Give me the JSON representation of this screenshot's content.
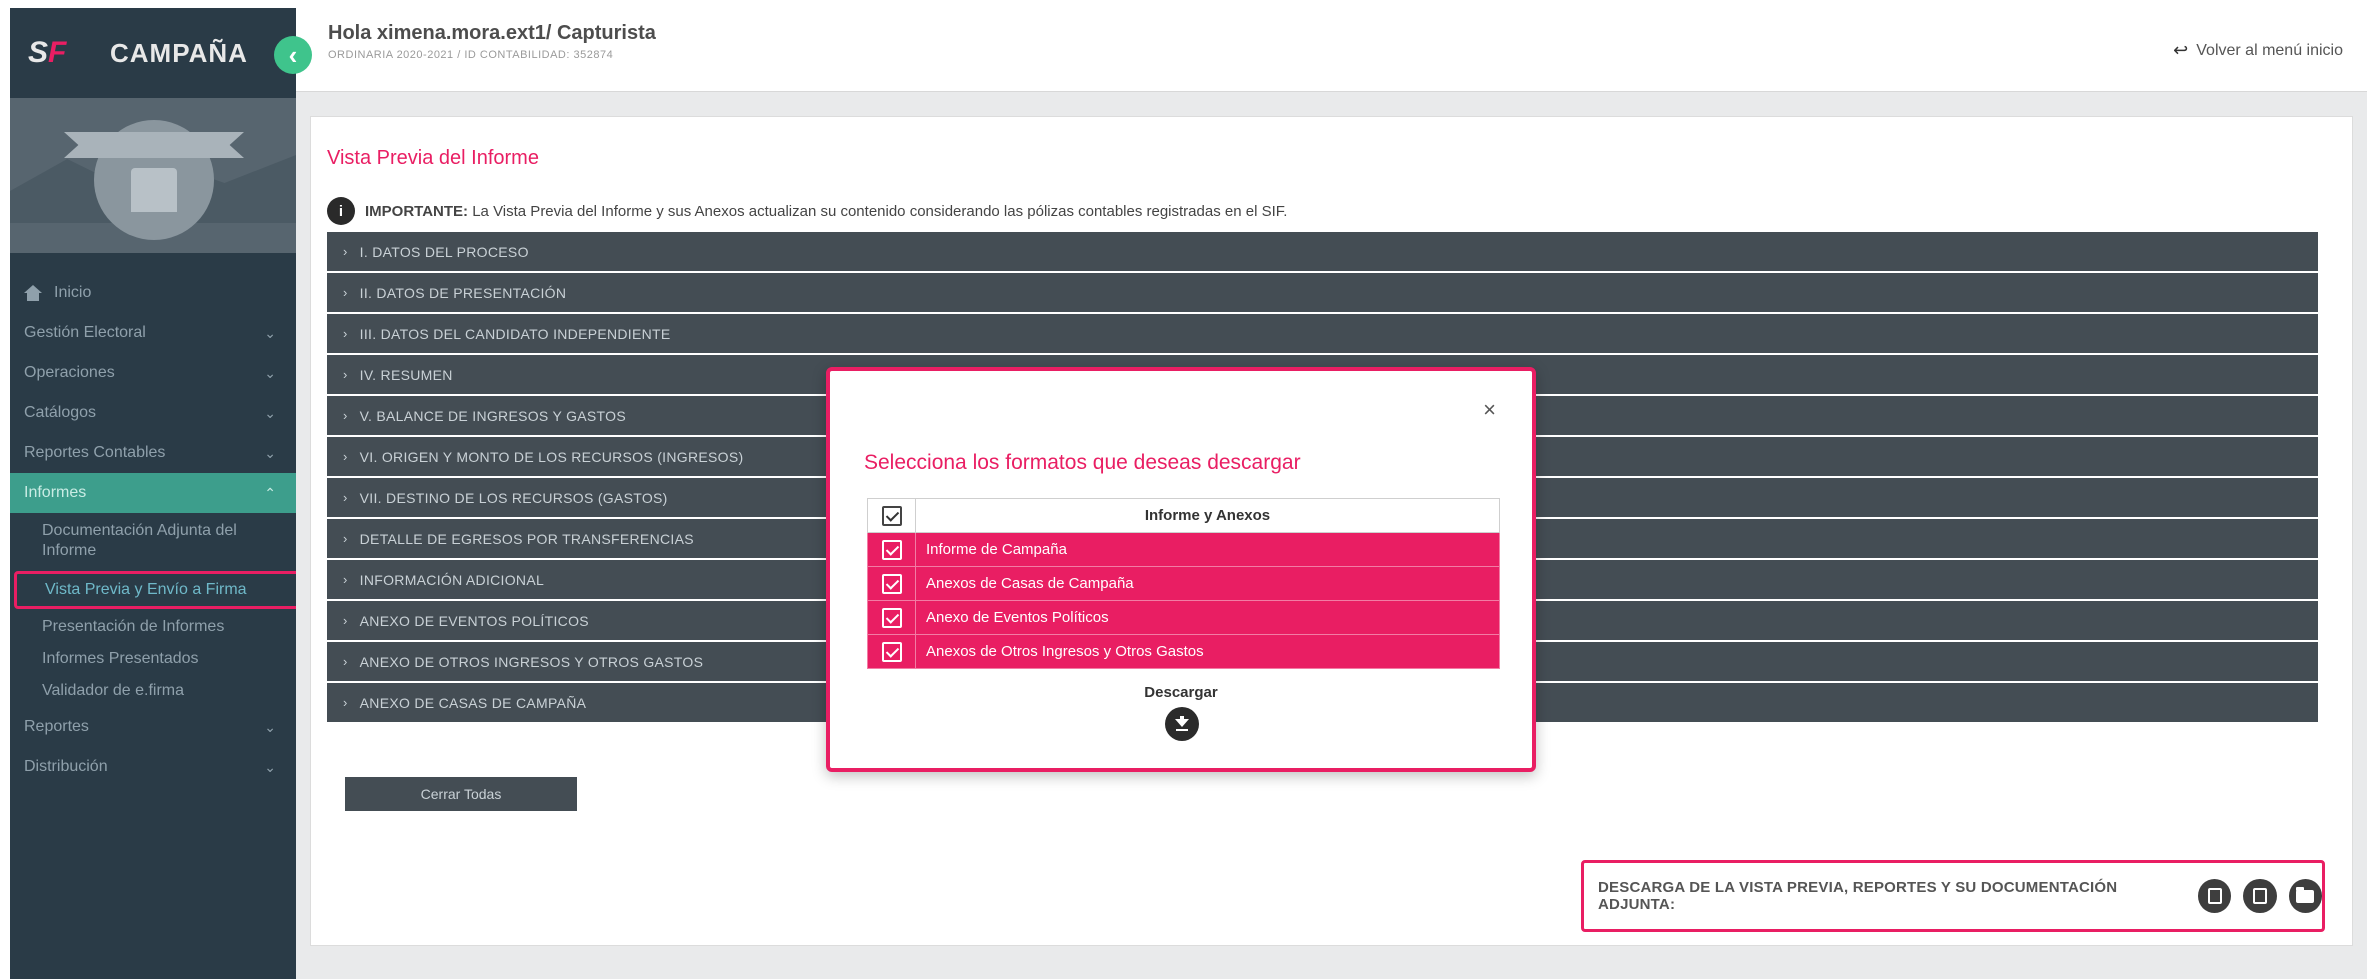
{
  "sidebar": {
    "brand": "CAMPAÑA",
    "nav": [
      {
        "label": "Inicio"
      },
      {
        "label": "Gestión Electoral"
      },
      {
        "label": "Operaciones"
      },
      {
        "label": "Catálogos"
      },
      {
        "label": "Reportes Contables"
      },
      {
        "label": "Informes"
      }
    ],
    "sub_items": [
      {
        "label": "Documentación Adjunta del Informe"
      },
      {
        "label": "Vista Previa y Envío a Firma"
      },
      {
        "label": "Presentación de Informes"
      },
      {
        "label": "Informes Presentados"
      },
      {
        "label": "Validador de e.firma"
      }
    ],
    "nav_after": [
      {
        "label": "Reportes"
      },
      {
        "label": "Distribución"
      }
    ]
  },
  "header": {
    "greeting": "Hola ximena.mora.ext1/ Capturista",
    "subtitle": "ORDINARIA 2020-2021 / ID CONTABILIDAD: 352874",
    "back_link": "Volver al menú inicio"
  },
  "content": {
    "title": "Vista Previa del Informe",
    "notice_bold": "IMPORTANTE:",
    "notice_text": " La Vista Previa del Informe y sus Anexos actualizan su contenido considerando las pólizas contables registradas en el SIF.",
    "sections": [
      "I. DATOS DEL PROCESO",
      "II. DATOS DE PRESENTACIÓN",
      "III. DATOS DEL CANDIDATO INDEPENDIENTE",
      "IV. RESUMEN",
      "V. BALANCE DE INGRESOS Y GASTOS",
      "VI. ORIGEN Y MONTO DE LOS RECURSOS (INGRESOS)",
      "VII. DESTINO DE LOS RECURSOS (GASTOS)",
      "DETALLE DE EGRESOS POR TRANSFERENCIAS",
      "INFORMACIÓN ADICIONAL",
      "ANEXO DE EVENTOS POLÍTICOS",
      "ANEXO DE OTROS INGRESOS Y OTROS GASTOS",
      "ANEXO DE CASAS DE CAMPAÑA"
    ],
    "close_all": "Cerrar Todas",
    "download_label": "DESCARGA DE LA VISTA PREVIA, REPORTES Y SU DOCUMENTACIÓN ADJUNTA:"
  },
  "modal": {
    "title": "Selecciona los formatos que deseas descargar",
    "close_symbol": "×",
    "table_header": "Informe y Anexos",
    "rows": [
      {
        "label": "Informe de Campaña",
        "checked": true
      },
      {
        "label": "Anexos de Casas de Campaña",
        "checked": true
      },
      {
        "label": "Anexo de Eventos Políticos",
        "checked": true
      },
      {
        "label": "Anexos de Otros Ingresos y Otros Gastos",
        "checked": true
      }
    ],
    "download_label": "Descargar"
  },
  "colors": {
    "accent": "#e91e63",
    "sidebar_bg": "#2a3b47",
    "accordion_bg": "#444d54",
    "active_group": "#3d9e8c"
  }
}
